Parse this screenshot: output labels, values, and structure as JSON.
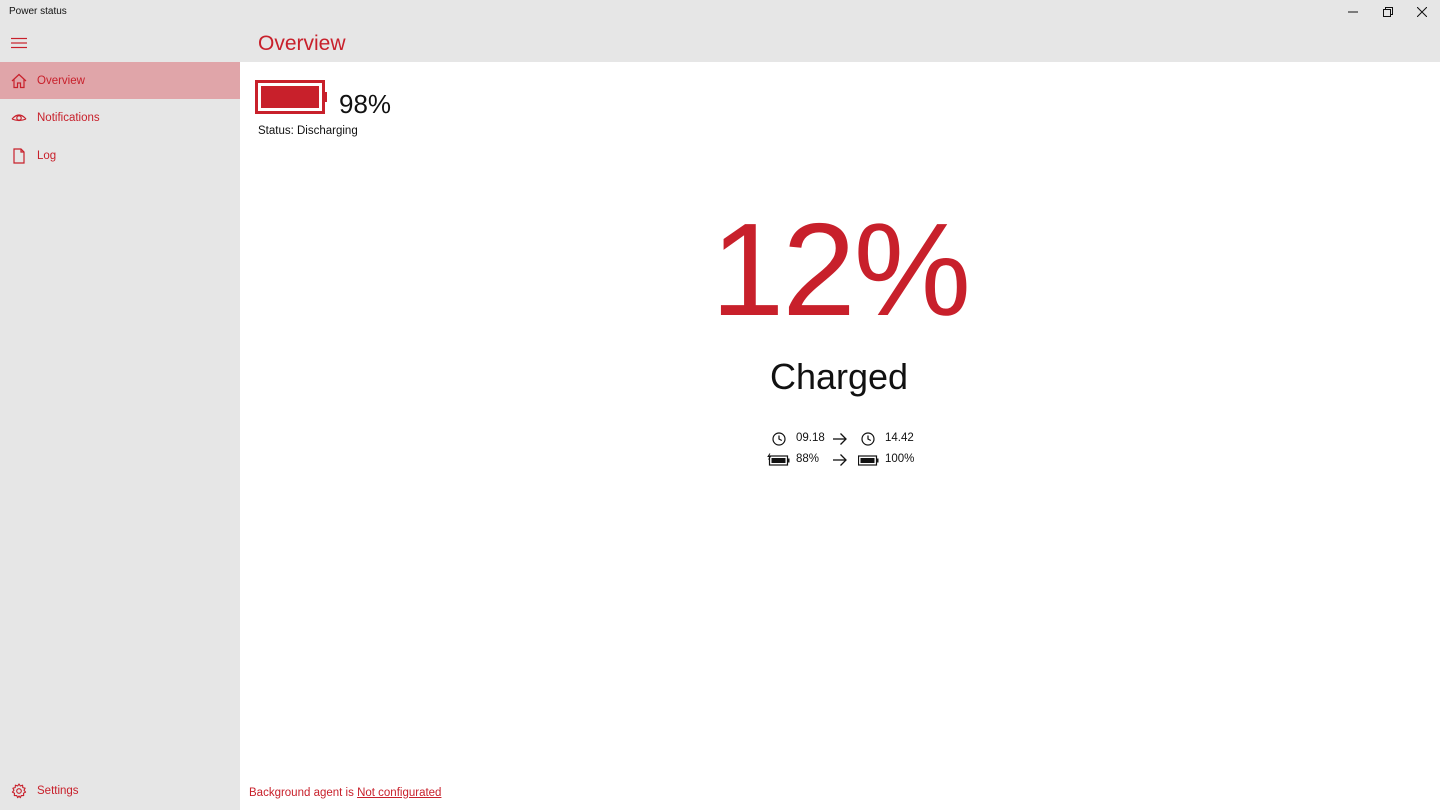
{
  "window": {
    "title": "Power status",
    "controls": [
      "minimize-icon",
      "restore-icon",
      "close-icon"
    ]
  },
  "colors": {
    "accent": "#c8202b",
    "selected_bg": "#e0a5a9",
    "chrome_bg": "#e6e6e6"
  },
  "sidebar": {
    "menu_icon": "hamburger-icon",
    "items": [
      {
        "label": "Overview",
        "icon": "home-icon",
        "selected": true
      },
      {
        "label": "Notifications",
        "icon": "eye-icon",
        "selected": false
      },
      {
        "label": "Log",
        "icon": "document-icon",
        "selected": false
      }
    ],
    "settings": {
      "label": "Settings",
      "icon": "gear-icon"
    }
  },
  "header": {
    "title": "Overview"
  },
  "battery": {
    "icon": "battery-icon",
    "percent": "98%",
    "level": 0.98,
    "status": "Status: Discharging"
  },
  "charge_summary": {
    "value": "12%",
    "label": "Charged",
    "time_start": "09.18",
    "time_end": "14.42",
    "pct_start": "88%",
    "pct_end": "100%"
  },
  "footer": {
    "agent_prefix": "Background agent is",
    "agent_link": "Not configurated"
  }
}
